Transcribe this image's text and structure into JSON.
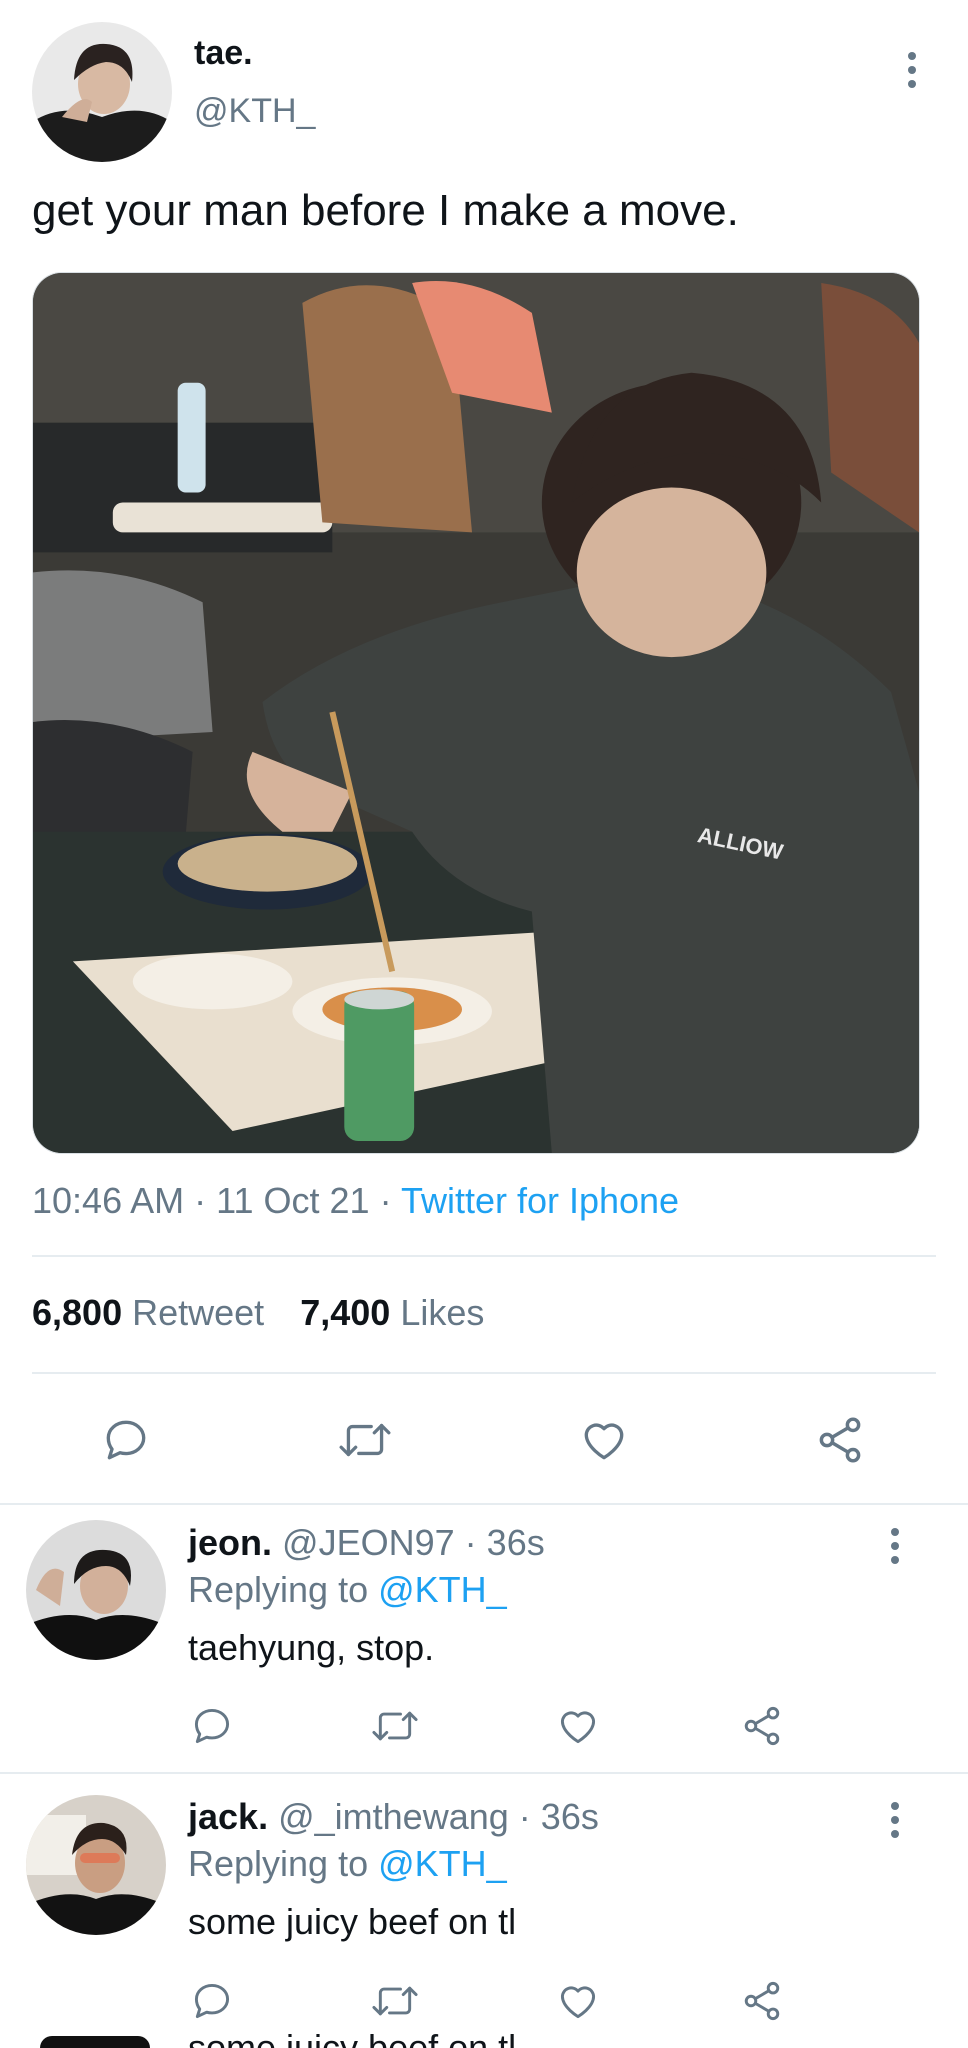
{
  "tweet": {
    "display_name": "tae.",
    "handle": "@KTH_",
    "text": "get your man before I make a move.",
    "time": "10:46 AM",
    "date": "11 Oct 21",
    "source": "Twitter for Iphone",
    "retweets_count": "6,800",
    "retweets_label": "Retweet",
    "likes_count": "7,400",
    "likes_label": "Likes",
    "image_caption": "ALLIOW"
  },
  "replies": [
    {
      "display_name": "jeon.",
      "handle": "@JEON97",
      "age": "36s",
      "replying_label": "Replying to",
      "replying_to": "@KTH_",
      "text": "taehyung, stop."
    },
    {
      "display_name": "jack.",
      "handle": "@_imthewang",
      "age": "36s",
      "replying_label": "Replying to",
      "replying_to": "@KTH_",
      "text": "some juicy beef on tl"
    }
  ],
  "cut_off_text": "some juicy beef on tl",
  "sep": "·",
  "colors": {
    "link": "#1da1f2",
    "muted": "#657786",
    "divider": "#e6ecf0"
  },
  "icons": [
    "more-vertical-icon",
    "reply-icon",
    "retweet-icon",
    "like-icon",
    "share-icon"
  ]
}
